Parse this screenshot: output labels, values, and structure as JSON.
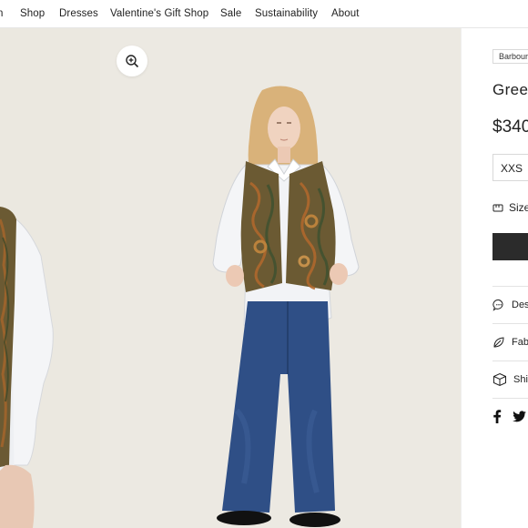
{
  "nav": {
    "items": [
      {
        "label": "n"
      },
      {
        "label": "Shop"
      },
      {
        "label": "Dresses"
      },
      {
        "label": "Valentine's Gift Shop"
      },
      {
        "label": "Sale"
      },
      {
        "label": "Sustainability"
      },
      {
        "label": "About"
      }
    ]
  },
  "gallery": {
    "zoom_icon": "zoom-in-icon"
  },
  "product": {
    "brand": "Barbour",
    "title": "Gree",
    "price": "$340",
    "size_selected": "XXS",
    "size_guide": "Size",
    "accordion": [
      {
        "label": "Des",
        "icon": "chat-bubble-icon"
      },
      {
        "label": "Fab",
        "icon": "leaf-icon"
      },
      {
        "label": "Shi",
        "icon": "box-icon"
      }
    ],
    "social": [
      "facebook-icon",
      "twitter-icon"
    ]
  },
  "colors": {
    "background": "#ece9e1",
    "button": "#2b2b2b",
    "denim": "#2f4f86",
    "vest": "#6b5a33"
  }
}
